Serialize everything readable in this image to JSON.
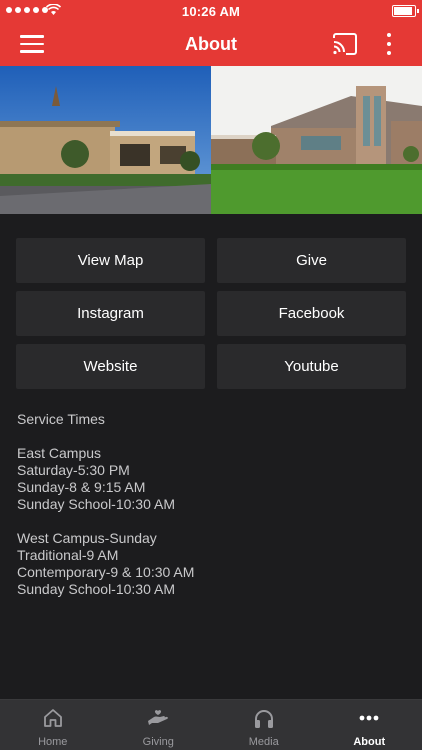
{
  "status_bar": {
    "time": "10:26 AM"
  },
  "app_bar": {
    "title": "About"
  },
  "buttons": [
    {
      "label": "View Map"
    },
    {
      "label": "Give"
    },
    {
      "label": "Instagram"
    },
    {
      "label": "Facebook"
    },
    {
      "label": "Website"
    },
    {
      "label": "Youtube"
    }
  ],
  "info": {
    "heading": "Service Times",
    "east": [
      "East Campus",
      "Saturday-5:30 PM",
      "Sunday-8 & 9:15 AM",
      "Sunday School-10:30 AM"
    ],
    "west": [
      "West Campus-Sunday",
      "Traditional-9 AM",
      "Contemporary-9 & 10:30 AM",
      "Sunday School-10:30 AM"
    ]
  },
  "tabs": [
    {
      "label": "Home",
      "icon": "home-icon"
    },
    {
      "label": "Giving",
      "icon": "giving-hand-icon"
    },
    {
      "label": "Media",
      "icon": "headphones-icon"
    },
    {
      "label": "About",
      "icon": "more-dots-icon",
      "active": true
    }
  ],
  "colors": {
    "accent": "#e53935",
    "background": "#1c1c1e",
    "button": "#2a2a2c",
    "tab_bar": "#333335"
  }
}
